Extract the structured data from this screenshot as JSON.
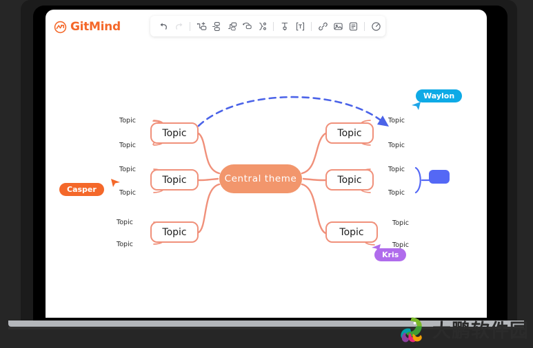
{
  "app": {
    "brand_name": "GitMind",
    "brand_icon": "gitmind-logo-icon"
  },
  "toolbar": {
    "items": [
      {
        "name": "undo-icon",
        "label": "Undo",
        "disabled": false
      },
      {
        "name": "redo-icon",
        "label": "Redo",
        "disabled": true
      },
      {
        "name": "separator",
        "label": "",
        "disabled": false
      },
      {
        "name": "add-sibling-node-icon",
        "label": "Add sibling topic",
        "disabled": false
      },
      {
        "name": "add-child-node-icon",
        "label": "Add child topic",
        "disabled": false
      },
      {
        "name": "add-parent-node-icon",
        "label": "Add parent topic",
        "disabled": false
      },
      {
        "name": "add-relation-icon",
        "label": "Add relationship",
        "disabled": false
      },
      {
        "name": "add-summary-icon",
        "label": "Add summary",
        "disabled": false
      },
      {
        "name": "separator",
        "label": "",
        "disabled": false
      },
      {
        "name": "style-brush-icon",
        "label": "Format painter",
        "disabled": false
      },
      {
        "name": "text-format-icon",
        "label": "Text style",
        "disabled": false
      },
      {
        "name": "separator",
        "label": "",
        "disabled": false
      },
      {
        "name": "link-icon",
        "label": "Insert link",
        "disabled": false
      },
      {
        "name": "image-icon",
        "label": "Insert image",
        "disabled": false
      },
      {
        "name": "note-icon",
        "label": "Insert note",
        "disabled": false
      },
      {
        "name": "separator",
        "label": "",
        "disabled": false
      },
      {
        "name": "history-icon",
        "label": "History",
        "disabled": false
      }
    ]
  },
  "mindmap": {
    "central": {
      "label": "Central  theme"
    },
    "branches": [
      {
        "id": "left-top",
        "label": "Topic",
        "side": "left",
        "leaves": [
          {
            "label": "Topic"
          },
          {
            "label": "Topic"
          }
        ]
      },
      {
        "id": "left-mid",
        "label": "Topic",
        "side": "left",
        "leaves": [
          {
            "label": "Topic"
          },
          {
            "label": "Topic"
          }
        ]
      },
      {
        "id": "left-bottom",
        "label": "Topic",
        "side": "left",
        "leaves": [
          {
            "label": "Topic"
          },
          {
            "label": "Topic"
          }
        ]
      },
      {
        "id": "right-top",
        "label": "Topic",
        "side": "right",
        "leaves": [
          {
            "label": "Topic"
          },
          {
            "label": "Topic"
          }
        ]
      },
      {
        "id": "right-mid",
        "label": "Topic",
        "side": "right",
        "leaves": [
          {
            "label": "Topic"
          },
          {
            "label": "Topic"
          }
        ]
      },
      {
        "id": "right-bottom",
        "label": "Topic",
        "side": "right",
        "leaves": [
          {
            "label": "Topic"
          },
          {
            "label": "Topic"
          }
        ]
      }
    ],
    "collapsed_node": {
      "label": ""
    },
    "relationship_arrow": {
      "style": "dashed",
      "color": "#4b63e8"
    }
  },
  "collaborators": [
    {
      "name": "Casper",
      "label": "Casper",
      "color": "#f4682a"
    },
    {
      "name": "Waylon",
      "label": "Waylon",
      "color": "#0eaae6"
    },
    {
      "name": "Kris",
      "label": "Kris",
      "color": "#b06cec"
    }
  ],
  "watermark": {
    "text": "大鹏软件园"
  },
  "colors": {
    "brand": "#f4682a",
    "node_border": "#f0907a",
    "central_fill": "#f2966c",
    "relation": "#4b63e8",
    "selection": "#5468f5"
  }
}
